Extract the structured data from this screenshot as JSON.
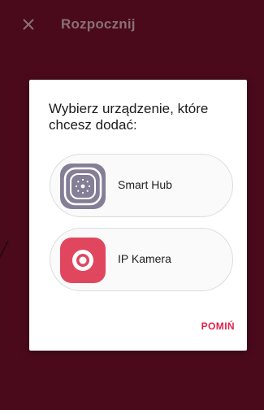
{
  "app_bar": {
    "close_icon": "close-icon",
    "title": "Rozpocznij"
  },
  "dialog": {
    "title": "Wybierz urządzenie, które chcesz dodać:",
    "options": [
      {
        "label": "Smart Hub",
        "icon": "smart-hub-icon",
        "icon_color": "#857e97"
      },
      {
        "label": "IP Kamera",
        "icon": "camera-icon",
        "icon_color": "#e0475e"
      }
    ],
    "skip_label": "POMIŃ"
  },
  "colors": {
    "background": "#4a0a1c",
    "accent": "#e0234b"
  }
}
